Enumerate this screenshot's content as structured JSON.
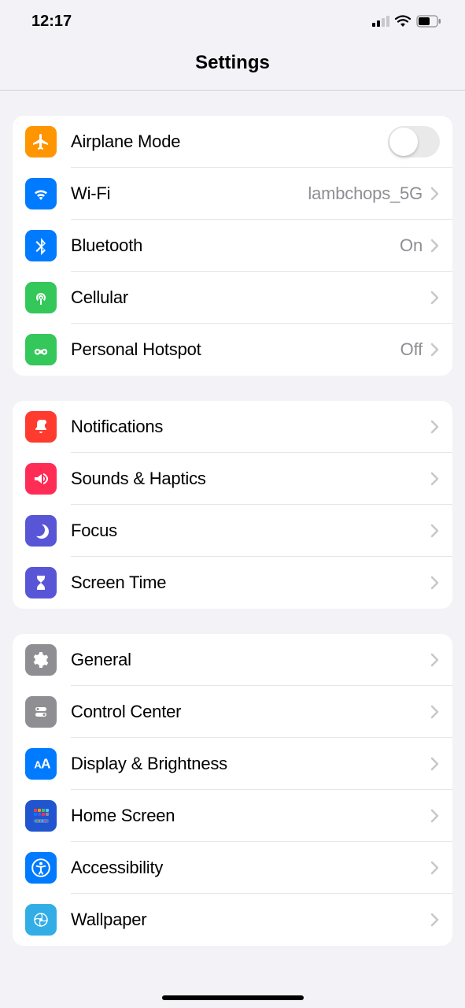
{
  "status": {
    "time": "12:17"
  },
  "header": {
    "title": "Settings"
  },
  "groups": [
    {
      "rows": [
        {
          "icon": "airplane-icon",
          "color": "ic-orange",
          "label": "Airplane Mode",
          "type": "toggle",
          "toggle": false
        },
        {
          "icon": "wifi-icon",
          "color": "ic-blue",
          "label": "Wi-Fi",
          "value": "lambchops_5G",
          "type": "nav"
        },
        {
          "icon": "bluetooth-icon",
          "color": "ic-blue",
          "label": "Bluetooth",
          "value": "On",
          "type": "nav"
        },
        {
          "icon": "cellular-icon",
          "color": "ic-green",
          "label": "Cellular",
          "type": "nav"
        },
        {
          "icon": "hotspot-icon",
          "color": "ic-green",
          "label": "Personal Hotspot",
          "value": "Off",
          "type": "nav"
        }
      ]
    },
    {
      "rows": [
        {
          "icon": "notifications-icon",
          "color": "ic-red",
          "label": "Notifications",
          "type": "nav"
        },
        {
          "icon": "sounds-icon",
          "color": "ic-pink",
          "label": "Sounds & Haptics",
          "type": "nav"
        },
        {
          "icon": "focus-icon",
          "color": "ic-indigo",
          "label": "Focus",
          "type": "nav"
        },
        {
          "icon": "screentime-icon",
          "color": "ic-indigo",
          "label": "Screen Time",
          "type": "nav"
        }
      ]
    },
    {
      "rows": [
        {
          "icon": "general-icon",
          "color": "ic-gray",
          "label": "General",
          "type": "nav"
        },
        {
          "icon": "controlcenter-icon",
          "color": "ic-gray",
          "label": "Control Center",
          "type": "nav"
        },
        {
          "icon": "display-icon",
          "color": "ic-blue",
          "label": "Display & Brightness",
          "type": "nav"
        },
        {
          "icon": "homescreen-icon",
          "color": "ic-darkblue",
          "label": "Home Screen",
          "type": "nav"
        },
        {
          "icon": "accessibility-icon",
          "color": "ic-blue",
          "label": "Accessibility",
          "type": "nav"
        },
        {
          "icon": "wallpaper-icon",
          "color": "ic-teal",
          "label": "Wallpaper",
          "type": "nav"
        }
      ]
    }
  ]
}
